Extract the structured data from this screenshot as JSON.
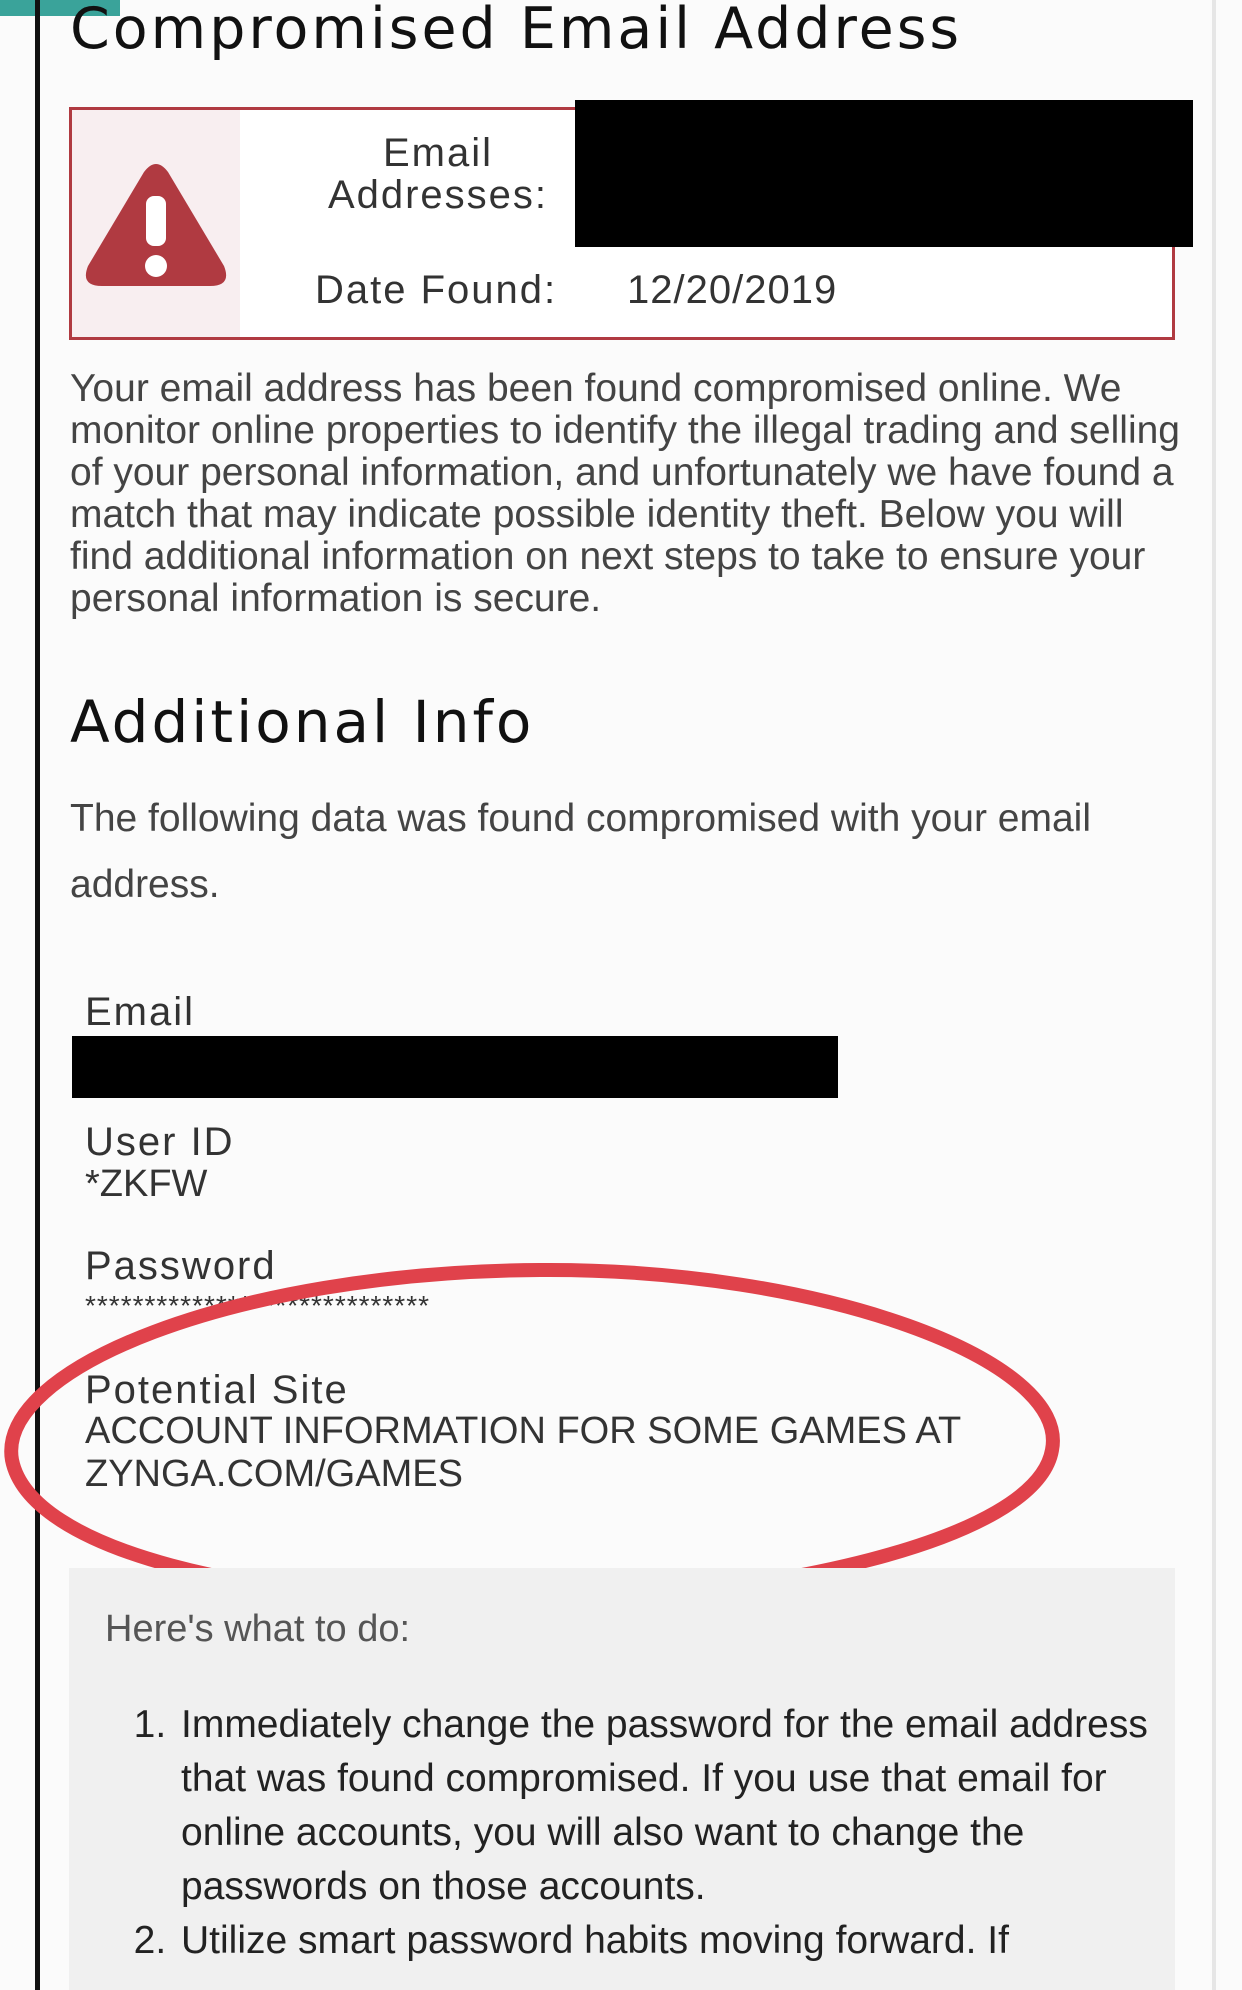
{
  "page": {
    "title": "Compromised Email Address",
    "alert": {
      "email_label": "Email Addresses:",
      "date_label": "Date Found:",
      "date_value": "12/20/2019"
    },
    "intro": "Your email address has been found compromised online. We monitor online properties to identify the illegal trading and selling of your personal information, and unfortunately we have found a match that may indicate possible identity theft. Below you will find additional information on next steps to take to ensure your personal information is secure.",
    "additional_heading": "Additional Info",
    "additional_text": "The following data was found compromised with your email address.",
    "fields": {
      "email_label": "Email",
      "userid_label": "User ID",
      "userid_value": "*ZKFW",
      "password_label": "Password",
      "password_value": "*****************************",
      "site_label": "Potential Site",
      "site_value": "ACCOUNT INFORMATION FOR SOME GAMES AT ZYNGA.COM/GAMES"
    },
    "todo": {
      "heading": "Here's what to do:",
      "items": [
        "Immediately change the password for the email address that was found compromised. If you use that email for online accounts, you will also want to change the passwords on those accounts.",
        "Utilize smart password habits moving forward. If"
      ]
    }
  },
  "colors": {
    "alert_red": "#b03a41",
    "annotation_red": "#e0424b",
    "accent_teal": "#3aa39a"
  },
  "icons": {
    "alert": "warning-triangle-icon"
  }
}
